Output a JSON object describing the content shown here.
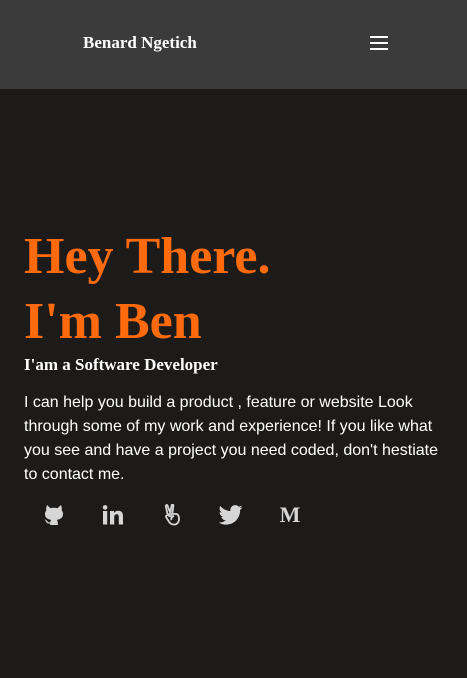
{
  "header": {
    "brand": "Benard Ngetich",
    "menu_icon": "hamburger-menu-icon"
  },
  "hero": {
    "line1": "Hey There.",
    "line2": "I'm Ben",
    "subtitle": "I'am a Software Developer",
    "bio": "I can help you build a product , feature or website Look through some of my work and experience! If you like what you see and have a project you need coded, don't hestiate to contact me."
  },
  "socials": {
    "items": [
      {
        "icon": "github-icon"
      },
      {
        "icon": "linkedin-icon"
      },
      {
        "icon": "angellist-icon"
      },
      {
        "icon": "twitter-icon"
      },
      {
        "icon": "medium-icon",
        "glyph": "M"
      }
    ]
  },
  "colors": {
    "page_background": "#1c1b1a",
    "header_background": "#3b3b3b",
    "accent": "#ff6a0d",
    "text": "#ffffff",
    "icon": "#d6d6d6"
  }
}
